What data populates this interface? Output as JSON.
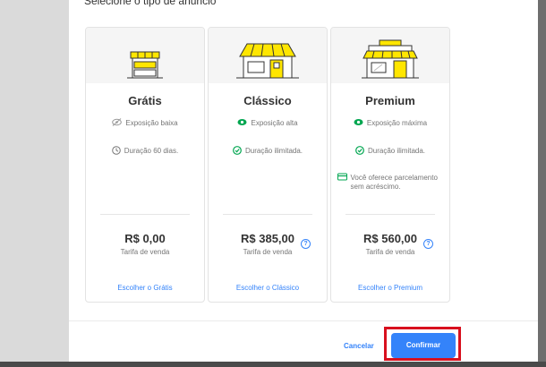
{
  "modal": {
    "heading": "Selecione o tipo de anúncio",
    "cards": [
      {
        "title": "Grátis",
        "features": [
          {
            "icon": "eye-off-icon",
            "text": "Exposição baixa"
          },
          {
            "icon": "clock-icon",
            "text": "Duração 60 dias."
          }
        ],
        "price": "R$ 0,00",
        "price_caption": "Tarifa de venda",
        "action": "Escolher o Grátis"
      },
      {
        "title": "Clássico",
        "features": [
          {
            "icon": "eye-icon",
            "text": "Exposição alta"
          },
          {
            "icon": "timer-check-icon",
            "text": "Duração ilimitada."
          }
        ],
        "price": "R$ 385,00",
        "price_caption": "Tarifa de venda",
        "help": "?",
        "action": "Escolher o Clássico"
      },
      {
        "title": "Premium",
        "features": [
          {
            "icon": "eye-icon",
            "text": "Exposição máxima"
          },
          {
            "icon": "timer-check-icon",
            "text": "Duração ilimitada."
          },
          {
            "icon": "credit-card-icon",
            "text": "Você oferece parcelamento sem acréscimo."
          }
        ],
        "price": "R$ 560,00",
        "price_caption": "Tarifa de venda",
        "help": "?",
        "action": "Escolher o Premium"
      }
    ],
    "footer": {
      "cancel_label": "Cancelar",
      "confirm_label": "Confirmar"
    }
  },
  "colors": {
    "accent": "#3483fa",
    "green": "#00a650",
    "yellow": "#ffe600",
    "highlight": "#d8101e"
  }
}
